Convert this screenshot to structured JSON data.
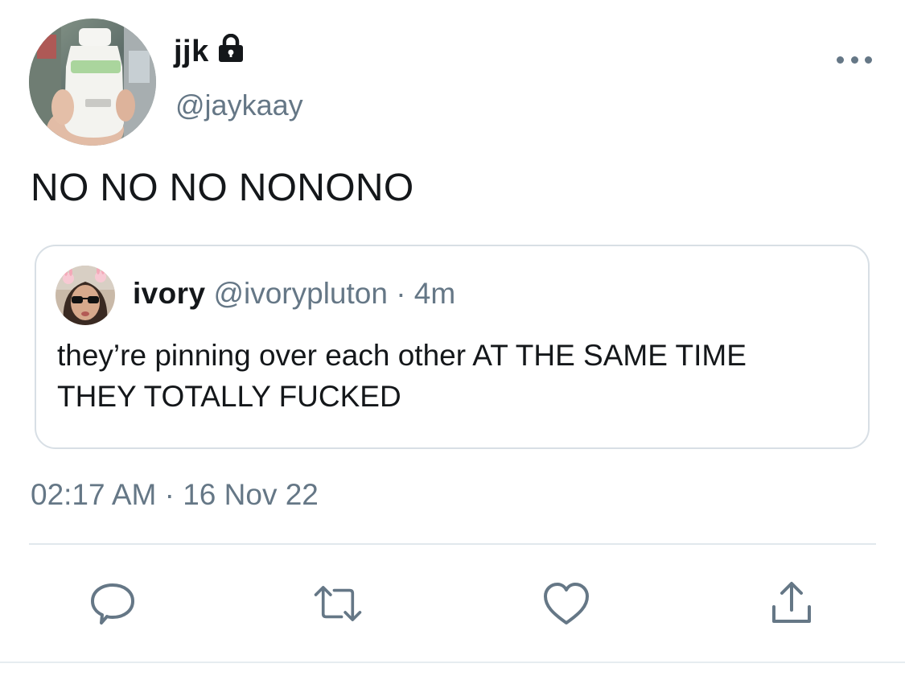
{
  "tweet": {
    "author": {
      "display_name": "jjk",
      "handle": "@jaykaay",
      "protected_icon": "lock-icon",
      "avatar_icon": "avatar"
    },
    "text": "NO NO NO NONONO",
    "timestamp": "02:17 AM · 16 Nov 22",
    "more_icon": "more-icon"
  },
  "quoted_tweet": {
    "display_name": "ivory",
    "meta": "@ivorypluton · 4m",
    "text": "they’re pinning over each other AT THE SAME TIME THEY TOTALLY FUCKED"
  },
  "actions": [
    {
      "icon": "reply-icon"
    },
    {
      "icon": "retweet-icon"
    },
    {
      "icon": "like-icon"
    },
    {
      "icon": "share-icon"
    }
  ],
  "colors": {
    "text_primary": "#14171a",
    "text_secondary": "#657786",
    "border": "#d8dfe5"
  }
}
